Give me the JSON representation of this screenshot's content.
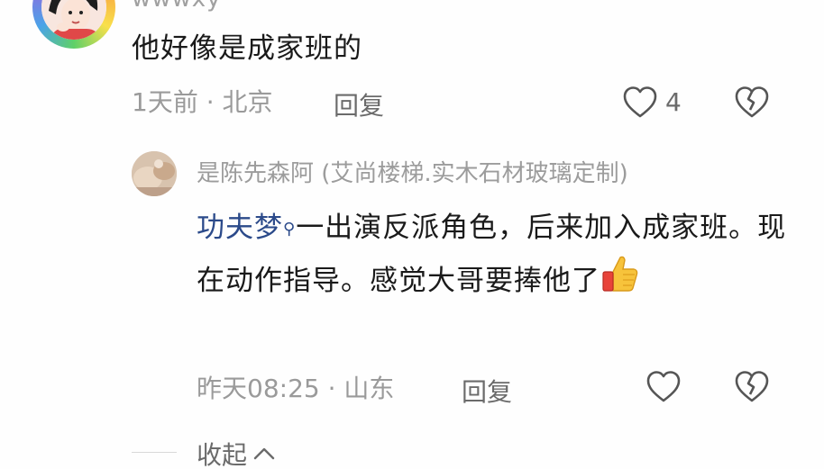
{
  "top_comment": {
    "username": "wwwxy",
    "text": "他好像是成家班的",
    "time_location": "1天前 · 北京",
    "reply_label": "回复",
    "like_count": "4"
  },
  "reply": {
    "username": "是陈先森阿 (艾尚楼梯.实木石材玻璃定制)",
    "mention": "功夫梦",
    "text": "一出演反派角色，后来加入成家班。现在动作指导。感觉大哥要捧他了",
    "time_location": "昨天08:25 · 山东",
    "reply_label": "回复"
  },
  "collapse_label": "收起",
  "colors": {
    "mention": "#2b4a8a",
    "meta": "#9a9a9a",
    "icon": "#555555"
  }
}
